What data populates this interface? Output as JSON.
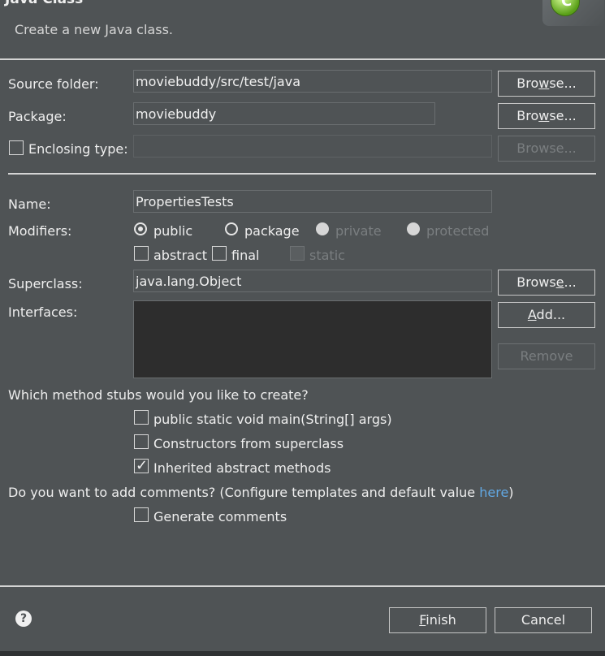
{
  "window": {
    "title": "Java Class",
    "subtitle": "Create a new Java class."
  },
  "source_folder": {
    "label": "Source folder:",
    "value": "moviebuddy/src/test/java",
    "button": "Browse..."
  },
  "package": {
    "label": "Package:",
    "value": "moviebuddy",
    "button": "Browse..."
  },
  "enclosing_type": {
    "label": "Enclosing type:",
    "value": "",
    "button": "Browse...",
    "checked": false
  },
  "name": {
    "label": "Name:",
    "value": "PropertiesTests"
  },
  "modifiers": {
    "label": "Modifiers:",
    "options": [
      "public",
      "package",
      "private",
      "protected"
    ],
    "selected": "public",
    "checks": [
      "abstract",
      "final",
      "static"
    ]
  },
  "superclass": {
    "label": "Superclass:",
    "value": "java.lang.Object",
    "button": "Browse..."
  },
  "interfaces": {
    "label": "Interfaces:",
    "add_button": "Add...",
    "remove_button": "Remove"
  },
  "stubs": {
    "question": "Which method stubs would you like to create?",
    "items": [
      {
        "label": "public static void main(String[] args)",
        "checked": false
      },
      {
        "label": "Constructors from superclass",
        "checked": false
      },
      {
        "label": "Inherited abstract methods",
        "checked": true
      }
    ]
  },
  "comments": {
    "question": "Do you want to add comments? (Configure templates and default value ",
    "link": "here",
    "question_end": ")",
    "generate": "Generate comments"
  },
  "footer": {
    "finish": "Finish",
    "cancel": "Cancel",
    "help": "?"
  },
  "colors": {
    "background": "#4f5355",
    "link": "#62a8e3",
    "list_bg": "#2d2d2d"
  }
}
